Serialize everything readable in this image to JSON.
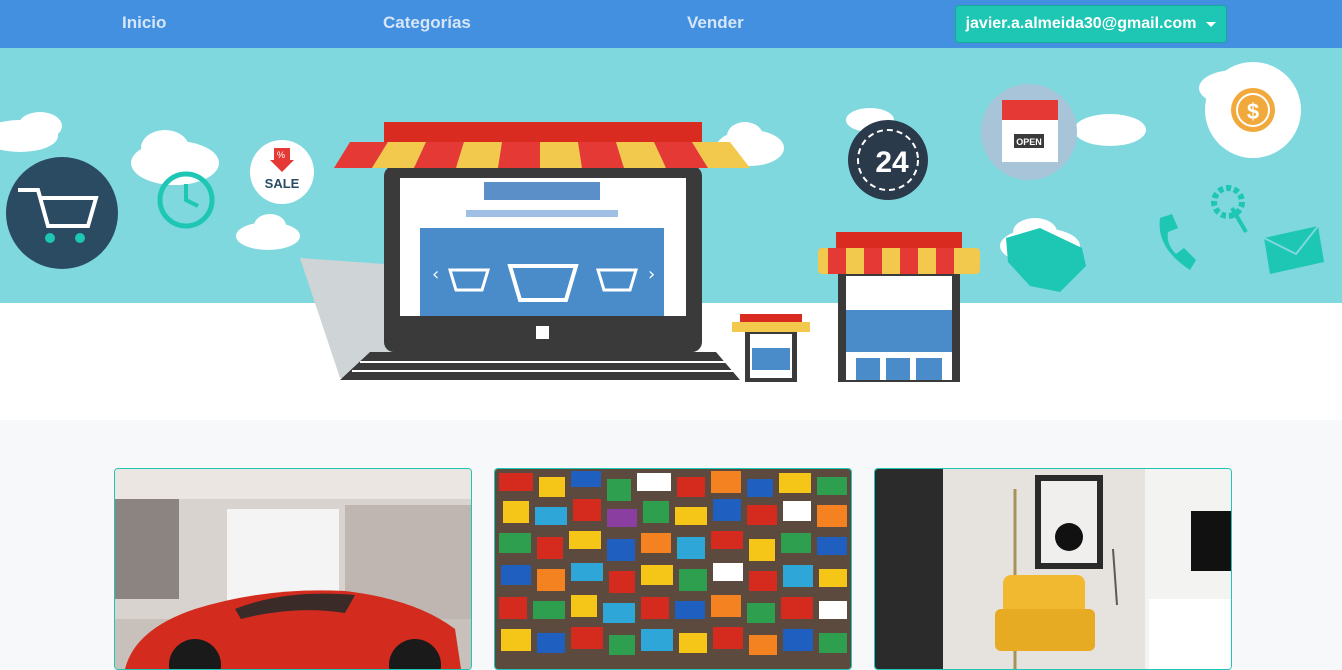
{
  "nav": {
    "inicio": "Inicio",
    "categorias": "Categorías",
    "vender": "Vender",
    "user_email": "javier.a.almeida30@gmail.com"
  },
  "hero": {
    "sale_badge": "SALE",
    "percent": "%",
    "hours_badge": "24",
    "open_sign": "OPEN",
    "coin_symbol": "$"
  },
  "colors": {
    "navbar": "#4390e0",
    "accent": "#1ec6b4",
    "sky": "#7ed8de"
  }
}
